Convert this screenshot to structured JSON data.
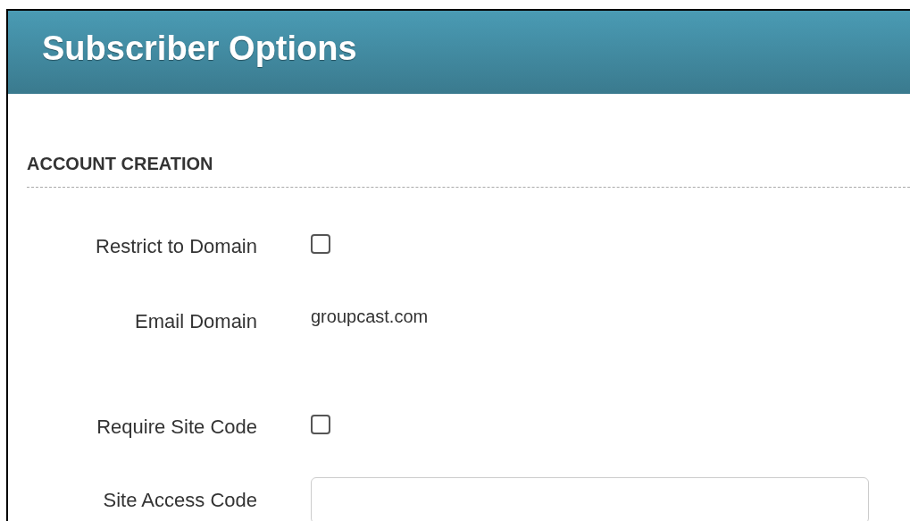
{
  "header": {
    "title": "Subscriber Options"
  },
  "section": {
    "title": "ACCOUNT CREATION"
  },
  "fields": [
    {
      "kind": "checkbox",
      "label": "Restrict to Domain",
      "checked": false
    },
    {
      "kind": "text",
      "label": "Email Domain",
      "value": "groupcast.com"
    },
    {
      "kind": "checkbox",
      "label": "Require Site Code",
      "checked": false
    },
    {
      "kind": "input",
      "label": "Site Access Code"
    }
  ]
}
